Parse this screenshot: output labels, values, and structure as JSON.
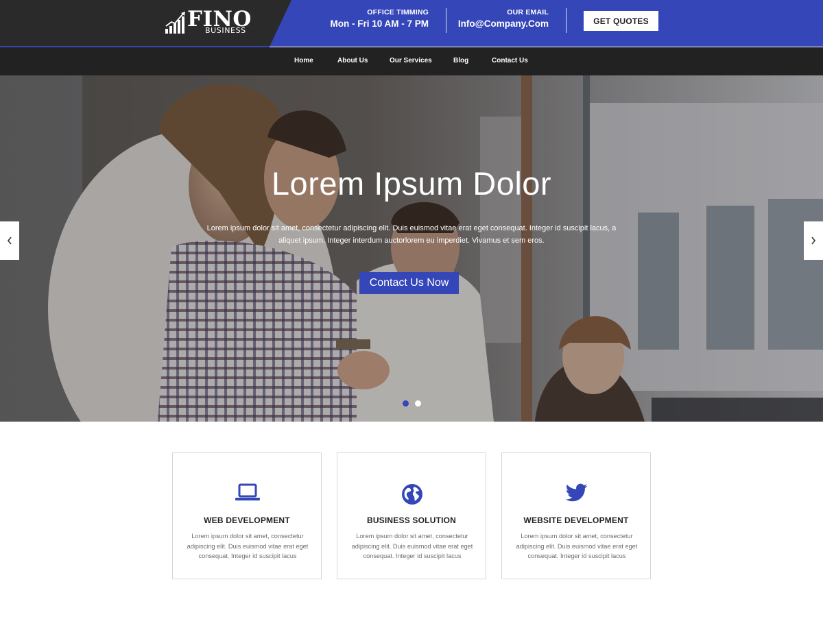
{
  "brand": {
    "logo_word": "FINO",
    "logo_sub": "BUSINESS"
  },
  "header": {
    "office_label": "OFFICE TIMMING",
    "office_value": "Mon - Fri 10 AM - 7 PM",
    "email_label": "OUR EMAIL",
    "email_value": "Info@Company.Com",
    "quote_button": "GET QUOTES"
  },
  "nav": {
    "items": [
      {
        "label": "Home"
      },
      {
        "label": "About Us"
      },
      {
        "label": "Our Services"
      },
      {
        "label": "Blog"
      },
      {
        "label": "Contact Us"
      }
    ]
  },
  "hero": {
    "title": "Lorem Ipsum Dolor",
    "text": "Lorem ipsum dolor sit amet, consectetur adipiscing elit. Duis euismod vitae erat eget consequat. Integer id suscipit lacus, a aliquet ipsum. Integer interdum auctorlorem eu imperdiet. Vivamus et sem eros.",
    "cta": "Contact Us Now",
    "active_slide": 1,
    "slide_count": 2
  },
  "services": [
    {
      "icon": "laptop-icon",
      "title": "WEB DEVELOPMENT",
      "text": "Lorem ipsum dolor sit amet, consectetur adipiscing elit. Duis euismod vitae erat eget consequat. Integer id suscipit lacus"
    },
    {
      "icon": "globe-icon",
      "title": "BUSINESS SOLUTION",
      "text": "Lorem ipsum dolor sit amet, consectetur adipiscing elit. Duis euismod vitae erat eget consequat. Integer id suscipit lacus"
    },
    {
      "icon": "twitter-bird-icon",
      "title": "WEBSITE DEVELOPMENT",
      "text": "Lorem ipsum dolor sit amet, consectetur adipiscing elit. Duis euismod vitae erat eget consequat. Integer id suscipit lacus"
    }
  ],
  "colors": {
    "accent": "#3546b8",
    "dark": "#2a2a2a",
    "nav": "#222222"
  }
}
